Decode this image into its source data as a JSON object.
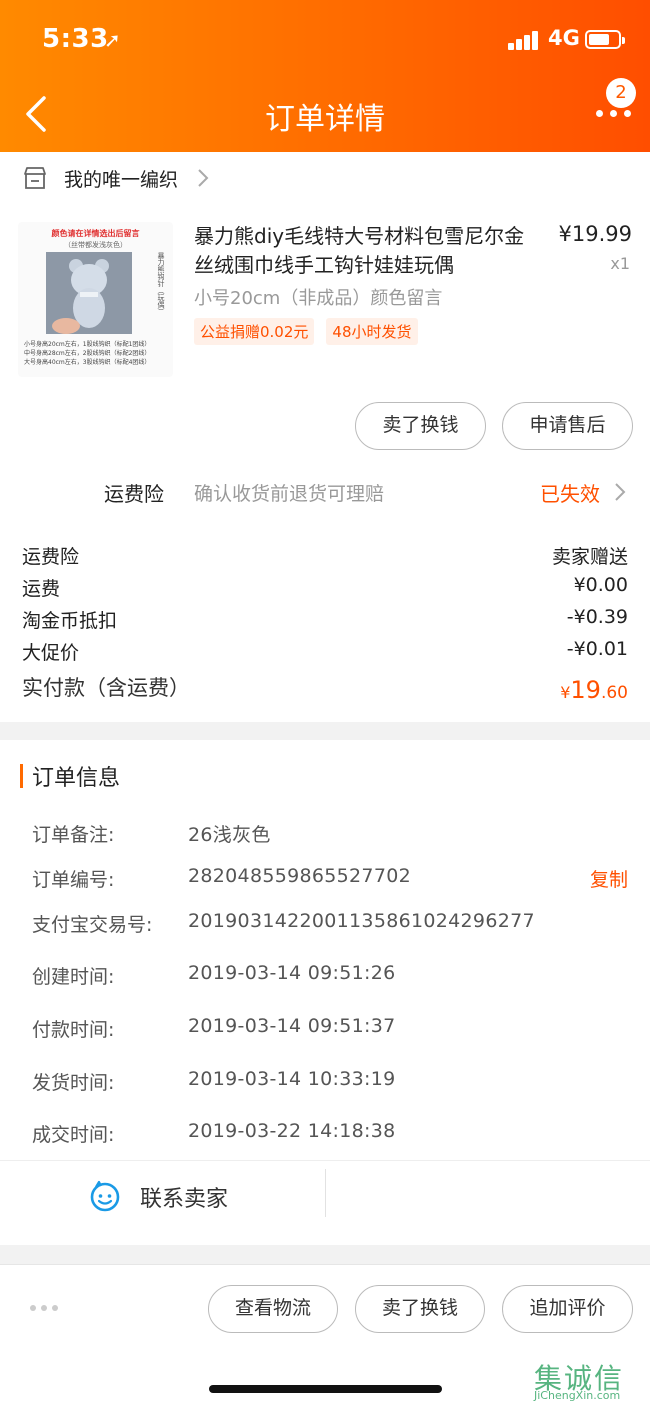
{
  "status_bar": {
    "time": "5:33",
    "network": "4G"
  },
  "nav": {
    "title": "订单详情",
    "notification_count": "2"
  },
  "shop": {
    "name": "我的唯一编织"
  },
  "product": {
    "title": "暴力熊diy毛线特大号材料包雪尼尔金丝绒围巾线手工钩针娃娃玩偶",
    "price": "¥19.99",
    "quantity": "x1",
    "sku": "小号20cm（非成品）颜色留言",
    "tags": [
      "公益捐赠0.02元",
      "48小时发货"
    ],
    "image_text": {
      "caption": "颜色请在详情选出后留言",
      "subcaption": "（丝带都发浅灰色）",
      "side": "暴力熊钩针（玩偶）",
      "lines": [
        "小号身高20cm左右，1股线钩织（标配1团线）",
        "中号身高28cm左右，2股线钩织（标配2团线）",
        "大号身高40cm左右，3股线钩织（标配4团线）"
      ]
    }
  },
  "actions_top": {
    "exchange": "卖了换钱",
    "after_sale": "申请售后"
  },
  "insurance": {
    "label": "运费险",
    "description": "确认收货前退货可理赔",
    "status": "已失效"
  },
  "fees": [
    {
      "label": "运费险",
      "value": "卖家赠送"
    },
    {
      "label": "运费",
      "value": "¥0.00"
    },
    {
      "label": "淘金币抵扣",
      "value": "-¥0.39"
    },
    {
      "label": "大促价",
      "value": "-¥0.01"
    }
  ],
  "total": {
    "label": "实付款（含运费）",
    "currency": "¥",
    "integer": "19",
    "decimal": ".60"
  },
  "order_info": {
    "heading": "订单信息",
    "copy_label": "复制",
    "rows": [
      {
        "label": "订单备注:",
        "value": "26浅灰色"
      },
      {
        "label": "订单编号:",
        "value": "282048559865527702"
      },
      {
        "label": "支付宝交易号:",
        "value": "2019031422001135861024296277"
      },
      {
        "label": "创建时间:",
        "value": "2019-03-14 09:51:26"
      },
      {
        "label": "付款时间:",
        "value": "2019-03-14 09:51:37"
      },
      {
        "label": "发货时间:",
        "value": "2019-03-14 10:33:19"
      },
      {
        "label": "成交时间:",
        "value": "2019-03-22 14:18:38"
      }
    ],
    "contact_seller": "联系卖家"
  },
  "bottom_actions": {
    "logistics": "查看物流",
    "exchange": "卖了换钱",
    "review": "追加评价"
  },
  "watermark": {
    "text": "集诚信",
    "url": "JiChengXin.com"
  },
  "colors": {
    "accent": "#ff5000",
    "header_start": "#ff8a00",
    "header_end": "#ff4e00"
  }
}
